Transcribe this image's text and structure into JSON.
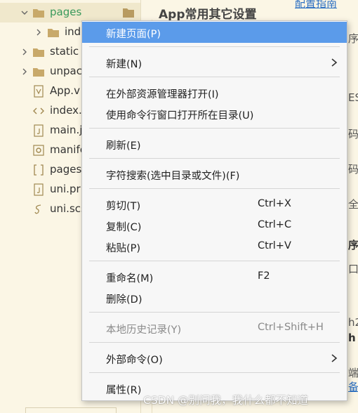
{
  "panel": {
    "title": "App常用其它设置",
    "config_link": "配置指南"
  },
  "tree": [
    {
      "label": "pages"
    },
    {
      "label": "ind"
    },
    {
      "label": "static"
    },
    {
      "label": "unpac"
    },
    {
      "label": "App.v"
    },
    {
      "label": "index."
    },
    {
      "label": "main.j"
    },
    {
      "label": "manife"
    },
    {
      "label": "pages"
    },
    {
      "label": "uni.pr"
    },
    {
      "label": "uni.scs"
    }
  ],
  "menu": {
    "new_page": "新建页面(P)",
    "new": "新建(N)",
    "open_explorer": "在外部资源管理器打开(I)",
    "open_cmd": "使用命令行窗口打开所在目录(U)",
    "refresh": "刷新(E)",
    "char_search": "字符搜索(选中目录或文件)(F)",
    "cut": "剪切(T)",
    "cut_key": "Ctrl+X",
    "copy": "复制(C)",
    "copy_key": "Ctrl+C",
    "paste": "粘贴(P)",
    "paste_key": "Ctrl+V",
    "rename": "重命名(M)",
    "rename_key": "F2",
    "delete": "删除(D)",
    "history": "本地历史记录(Y)",
    "history_key": "Ctrl+Shift+H",
    "external_cmd": "外部命令(O)",
    "properties": "属性(R)"
  },
  "edge_text": [
    "序",
    "ES",
    "码",
    "码",
    "全",
    "序",
    "口",
    "h2",
    "h",
    "端",
    "备"
  ],
  "watermark": "CSDN @别问我，我什么都不知道",
  "colors": {
    "highlight": "#5b9bea",
    "background": "#fbf6e5",
    "folder": "#c8a96a",
    "selected_text": "#3a9a5c",
    "link": "#2b6fc2"
  }
}
